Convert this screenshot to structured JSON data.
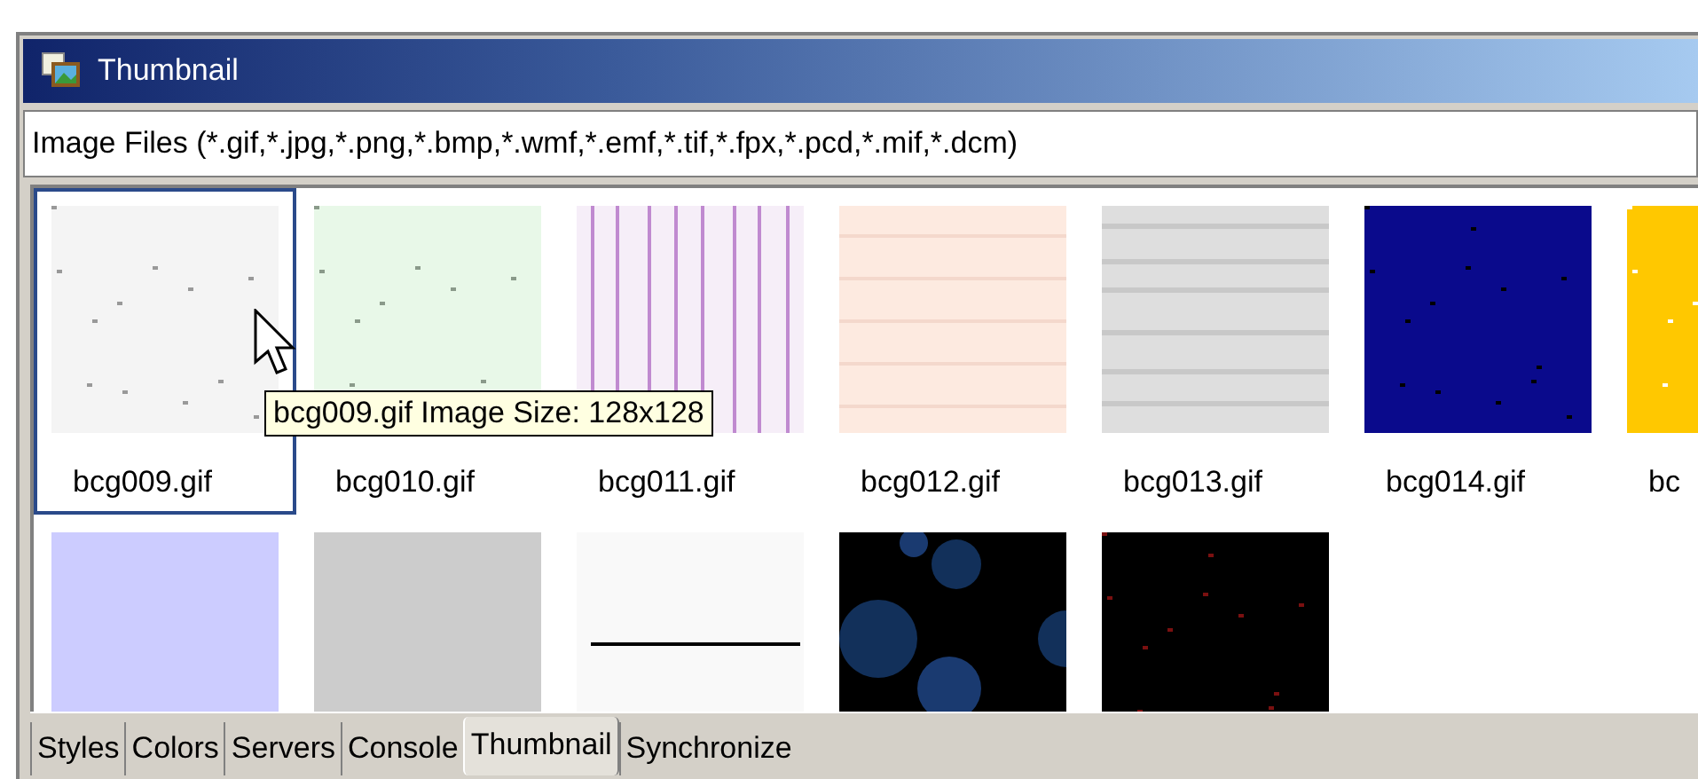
{
  "window": {
    "title": "Thumbnail"
  },
  "filter": {
    "value": "Image Files (*.gif,*.jpg,*.png,*.bmp,*.wmf,*.emf,*.tif,*.fpx,*.pcd,*.mif,*.dcm)"
  },
  "thumbnail_rows": [
    [
      {
        "label": "bcg009.gif",
        "selected": true
      },
      {
        "label": "bcg010.gif",
        "selected": false
      },
      {
        "label": "bcg011.gif",
        "selected": false
      },
      {
        "label": "bcg012.gif",
        "selected": false
      },
      {
        "label": "bcg013.gif",
        "selected": false
      },
      {
        "label": "bcg014.gif",
        "selected": false
      },
      {
        "label": "bc",
        "selected": false
      }
    ],
    [
      {
        "selected": false
      },
      {
        "selected": false
      },
      {
        "selected": false
      },
      {
        "selected": false
      },
      {
        "selected": false
      }
    ]
  ],
  "tooltip": "bcg009.gif Image Size: 128x128",
  "tabs": [
    {
      "label": "Styles",
      "selected": false
    },
    {
      "label": "Colors",
      "selected": false
    },
    {
      "label": "Servers",
      "selected": false
    },
    {
      "label": "Console",
      "selected": false
    },
    {
      "label": "Thumbnail",
      "selected": true
    },
    {
      "label": "Synchronize",
      "selected": false
    }
  ]
}
